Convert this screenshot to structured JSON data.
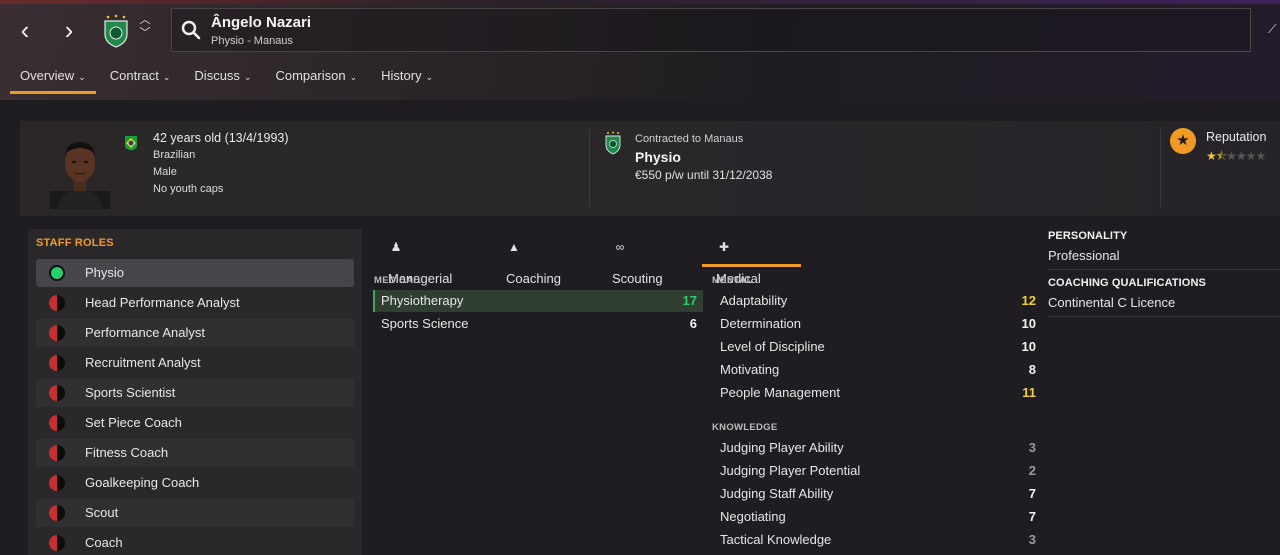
{
  "header": {
    "name": "Ângelo Nazari",
    "subtitle": "Physio - Manaus",
    "tabs": [
      {
        "label": "Overview"
      },
      {
        "label": "Contract"
      },
      {
        "label": "Discuss"
      },
      {
        "label": "Comparison"
      },
      {
        "label": "History"
      }
    ]
  },
  "profile": {
    "age": "42 years old (13/4/1993)",
    "nationality": "Brazilian",
    "gender": "Male",
    "caps": "No youth caps"
  },
  "contract": {
    "club": "Contracted to Manaus",
    "role": "Physio",
    "wage": "€550 p/w until 31/12/2038"
  },
  "reputation": {
    "label": "Reputation",
    "stars": 1.5,
    "max_stars": 6
  },
  "staff_roles": {
    "title": "STAFF ROLES",
    "items": [
      {
        "label": "Physio"
      },
      {
        "label": "Head Performance Analyst"
      },
      {
        "label": "Performance Analyst"
      },
      {
        "label": "Recruitment Analyst"
      },
      {
        "label": "Sports Scientist"
      },
      {
        "label": "Set Piece Coach"
      },
      {
        "label": "Fitness Coach"
      },
      {
        "label": "Goalkeeping Coach"
      },
      {
        "label": "Scout"
      },
      {
        "label": "Coach"
      }
    ]
  },
  "attr_tabs": [
    {
      "label": "Managerial"
    },
    {
      "label": "Coaching"
    },
    {
      "label": "Scouting"
    },
    {
      "label": "Medical"
    }
  ],
  "medical": {
    "label": "MEDICAL",
    "rows": [
      {
        "name": "Physiotherapy",
        "value": "17"
      },
      {
        "name": "Sports Science",
        "value": "6"
      }
    ]
  },
  "mental": {
    "label": "MENTAL",
    "rows": [
      {
        "name": "Adaptability",
        "value": "12"
      },
      {
        "name": "Determination",
        "value": "10"
      },
      {
        "name": "Level of Discipline",
        "value": "10"
      },
      {
        "name": "Motivating",
        "value": "8"
      },
      {
        "name": "People Management",
        "value": "11"
      }
    ]
  },
  "knowledge": {
    "label": "KNOWLEDGE",
    "rows": [
      {
        "name": "Judging Player Ability",
        "value": "3"
      },
      {
        "name": "Judging Player Potential",
        "value": "2"
      },
      {
        "name": "Judging Staff Ability",
        "value": "7"
      },
      {
        "name": "Negotiating",
        "value": "7"
      },
      {
        "name": "Tactical Knowledge",
        "value": "3"
      }
    ]
  },
  "personality": {
    "title": "PERSONALITY",
    "value": "Professional"
  },
  "qualifications": {
    "title": "COACHING QUALIFICATIONS",
    "value": "Continental C Licence"
  },
  "colors": {
    "accent": "#f29b24",
    "good": "#27d06b",
    "mid": "#f2d22e",
    "low": "#9b9b9b"
  }
}
